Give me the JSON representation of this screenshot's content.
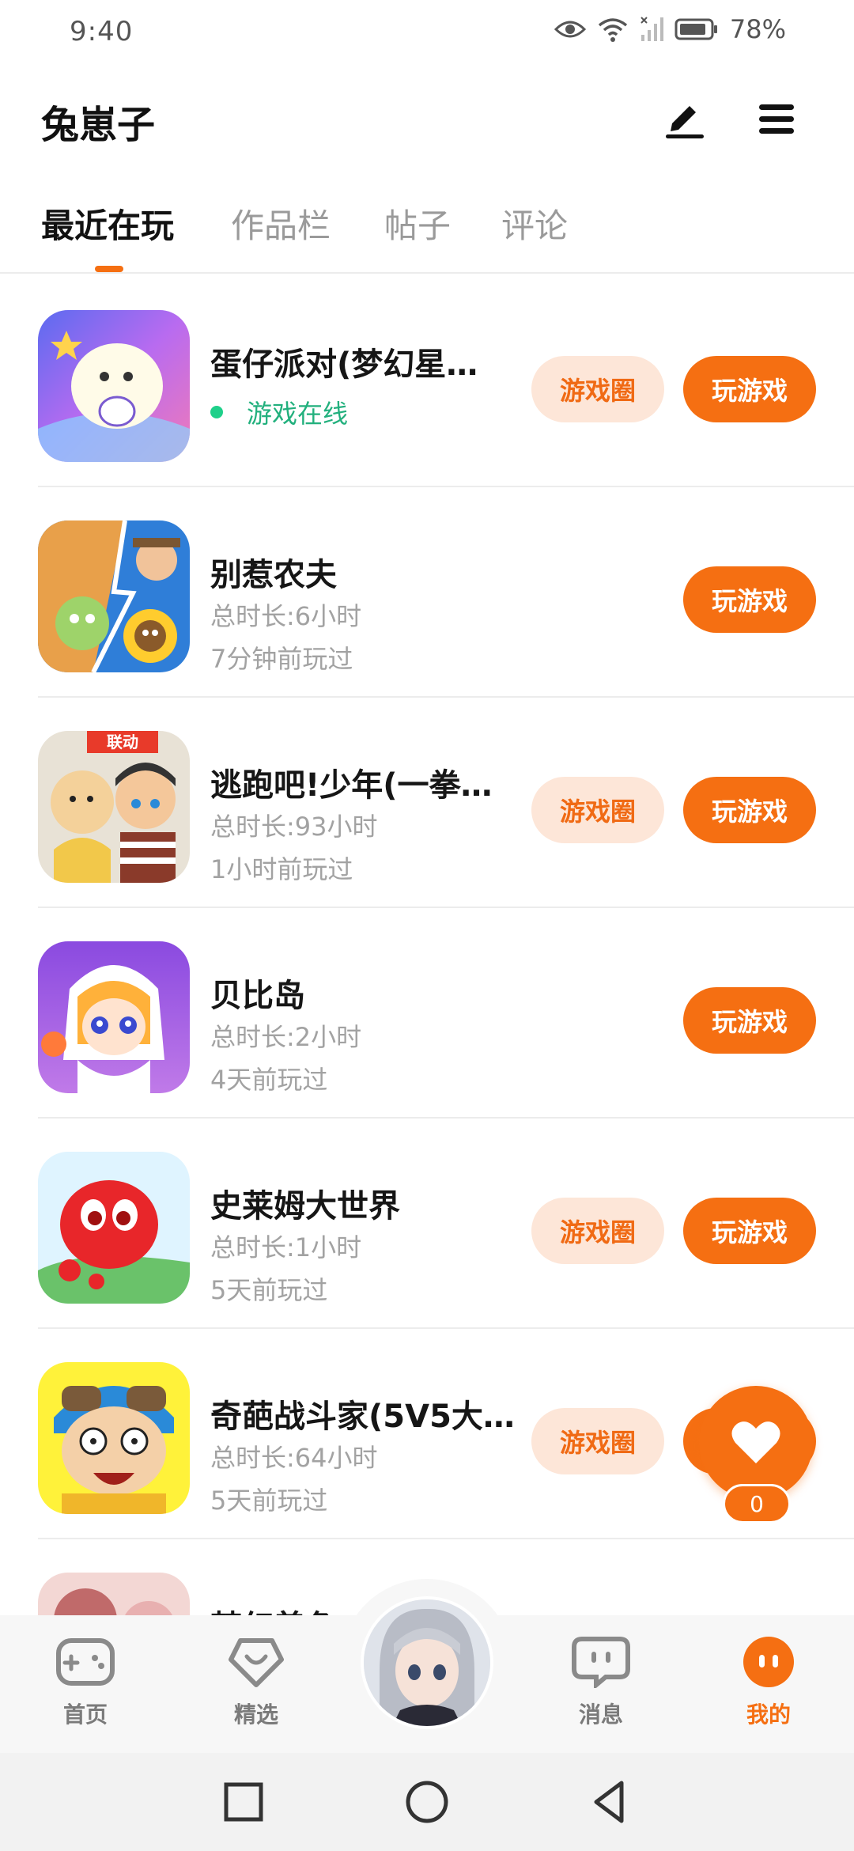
{
  "status_bar": {
    "time": "9:40",
    "battery": "78%",
    "icons": [
      "eye-icon",
      "wifi-icon",
      "signal-icon",
      "battery-icon"
    ]
  },
  "header": {
    "title": "兔崽子",
    "edit_icon": "pen-icon",
    "menu_icon": "menu-icon"
  },
  "tabs": [
    {
      "label": "最近在玩",
      "active": true
    },
    {
      "label": "作品栏",
      "active": false
    },
    {
      "label": "帖子",
      "active": false
    },
    {
      "label": "评论",
      "active": false
    }
  ],
  "games": [
    {
      "name": "蛋仔派对(梦幻星…",
      "online": "游戏在线",
      "circle": "游戏圈",
      "play": "玩游戏"
    },
    {
      "name": "别惹农夫",
      "total": "总时长:6小时",
      "last": "7分钟前玩过",
      "play": "玩游戏"
    },
    {
      "name": "逃跑吧!少年(一拳…",
      "total": "总时长:93小时",
      "last": "1小时前玩过",
      "circle": "游戏圈",
      "play": "玩游戏",
      "badge": "联动"
    },
    {
      "name": "贝比岛",
      "total": "总时长:2小时",
      "last": "4天前玩过",
      "play": "玩游戏"
    },
    {
      "name": "史莱姆大世界",
      "total": "总时长:1小时",
      "last": "5天前玩过",
      "circle": "游戏圈",
      "play": "玩游戏"
    },
    {
      "name": "奇葩战斗家(5V5大…",
      "total": "总时长:64小时",
      "last": "5天前玩过",
      "circle": "游戏圈",
      "play": "玩游戏"
    },
    {
      "name": "梦幻着色"
    }
  ],
  "fab": {
    "count": "0",
    "icon": "heart-icon"
  },
  "bottom_nav": [
    {
      "label": "首页",
      "icon": "gamepad-icon"
    },
    {
      "label": "精选",
      "icon": "heart-box-icon"
    },
    {
      "label": "",
      "icon": "avatar"
    },
    {
      "label": "消息",
      "icon": "chat-icon"
    },
    {
      "label": "我的",
      "icon": "profile-icon",
      "active": true
    }
  ],
  "colors": {
    "accent": "#f56f12",
    "online": "#22b07d",
    "accent_light": "#fde6d8"
  }
}
